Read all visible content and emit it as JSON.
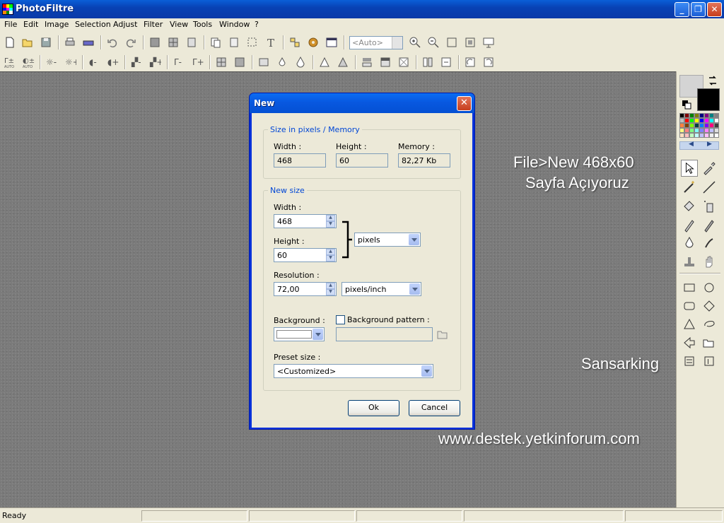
{
  "app": {
    "title": "PhotoFiltre"
  },
  "menu": [
    "File",
    "Edit",
    "Image",
    "Selection",
    "Adjust",
    "Filter",
    "View",
    "Tools",
    "Window",
    "?"
  ],
  "toolbar": {
    "zoom_value": "<Auto>"
  },
  "overlay": {
    "line1": "File>New 468x60",
    "line2": "Sayfa Açıyoruz",
    "author": "Sansarking",
    "url": "www.destek.yetkinforum.com"
  },
  "dialog": {
    "title": "New",
    "size_group": {
      "label": "Size in pixels / Memory",
      "width_label": "Width :",
      "width_value": "468",
      "height_label": "Height :",
      "height_value": "60",
      "memory_label": "Memory :",
      "memory_value": "82,27 Kb"
    },
    "new_size_group": {
      "label": "New size",
      "width_label": "Width :",
      "width_value": "468",
      "height_label": "Height :",
      "height_value": "60",
      "unit": "pixels",
      "resolution_label": "Resolution :",
      "resolution_value": "72,00",
      "resolution_unit": "pixels/inch",
      "background_label": "Background :",
      "background_color": "#ffffff",
      "bg_pattern_label": "Background pattern :",
      "bg_pattern_checked": false,
      "preset_label": "Preset size :",
      "preset_value": "<Customized>"
    },
    "ok_label": "Ok",
    "cancel_label": "Cancel"
  },
  "status": {
    "text": "Ready"
  },
  "colors": {
    "foreground": "#d4d4d4",
    "background": "#000000",
    "palette": [
      "#000000",
      "#800000",
      "#008000",
      "#808000",
      "#000080",
      "#800080",
      "#008080",
      "#808080",
      "#c0c0c0",
      "#ff0000",
      "#00ff00",
      "#ffff00",
      "#0000ff",
      "#ff00ff",
      "#00ffff",
      "#ffffff",
      "#ff8040",
      "#804000",
      "#80ff00",
      "#004040",
      "#0080ff",
      "#8000ff",
      "#ff0080",
      "#404040",
      "#ffff80",
      "#ff8080",
      "#80ff80",
      "#80ffff",
      "#8080ff",
      "#ff80ff",
      "#c0c0ff",
      "#e0e0e0",
      "#ffe0c0",
      "#ffc0c0",
      "#c0ffc0",
      "#c0ffff",
      "#c0c0ff",
      "#ffc0ff",
      "#f0f0f0",
      "#ffffff"
    ]
  }
}
